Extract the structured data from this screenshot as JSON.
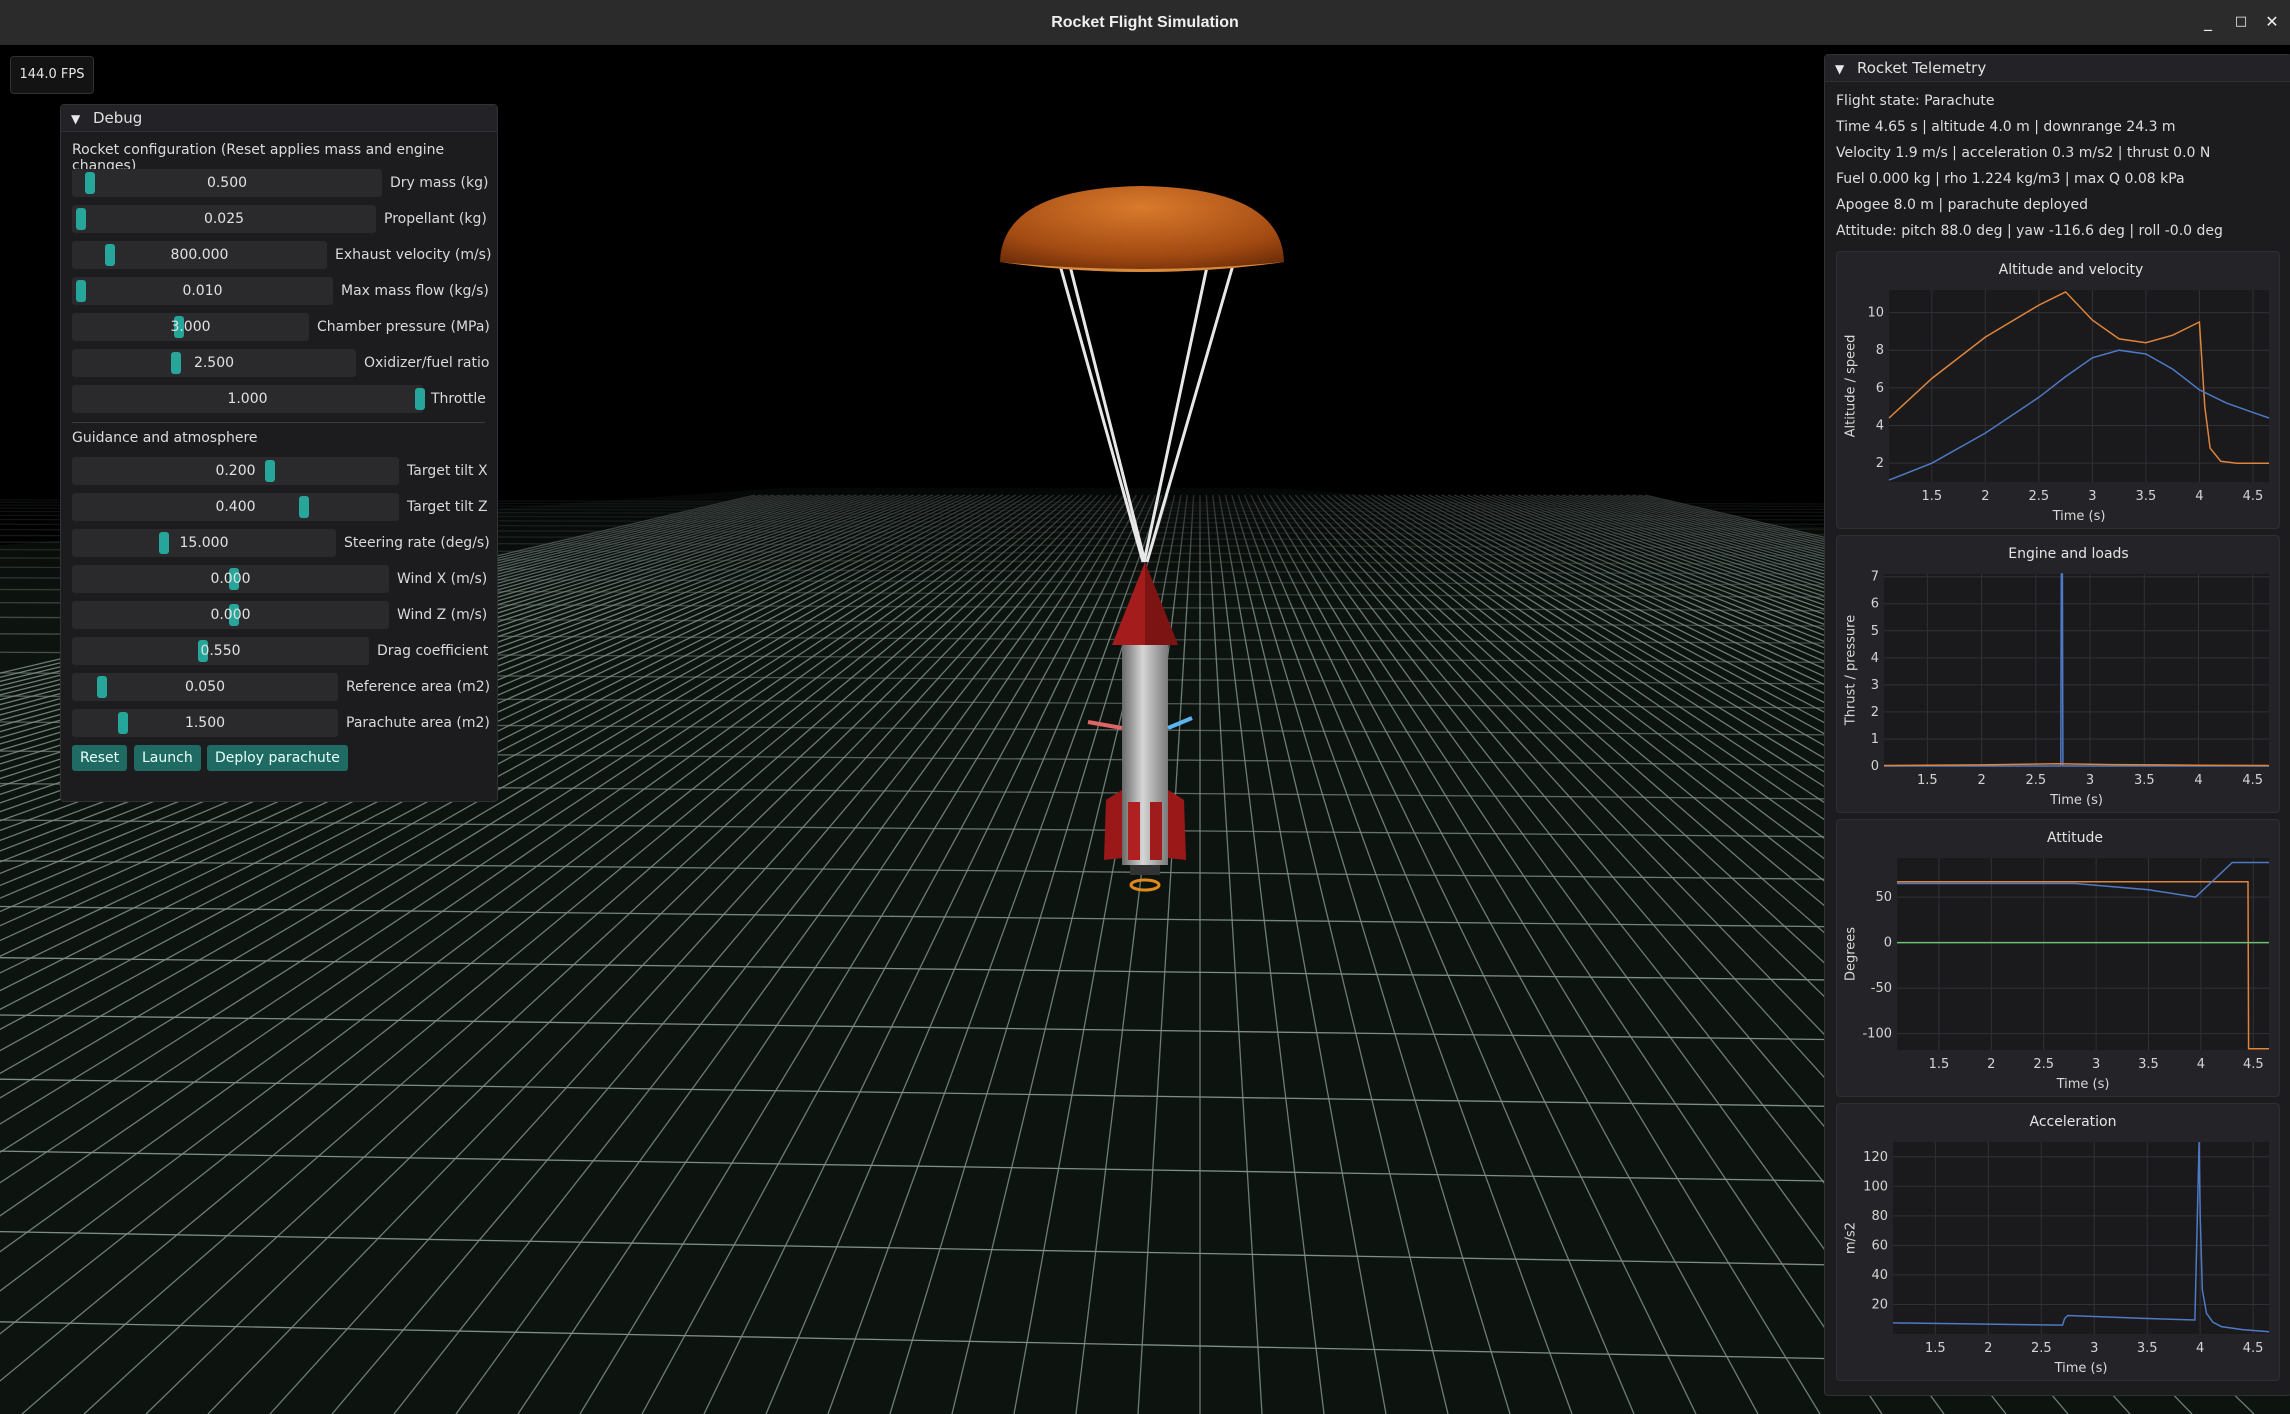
{
  "window": {
    "title": "Rocket Flight Simulation",
    "controls": {
      "minimize": "_",
      "maximize": "□",
      "close": "✕"
    }
  },
  "fps": "144.0 FPS",
  "debug": {
    "header": "Debug",
    "config_title": "Rocket configuration (Reset applies mass and engine changes)",
    "config_sliders": [
      {
        "value": "0.500",
        "label": "Dry mass (kg)"
      },
      {
        "value": "0.025",
        "label": "Propellant (kg)"
      },
      {
        "value": "800.000",
        "label": "Exhaust velocity (m/s)"
      },
      {
        "value": "0.010",
        "label": "Max mass flow (kg/s)"
      },
      {
        "value": "3.000",
        "label": "Chamber pressure (MPa)"
      },
      {
        "value": "2.500",
        "label": "Oxidizer/fuel ratio"
      },
      {
        "value": "1.000",
        "label": "Throttle"
      }
    ],
    "guidance_title": "Guidance and atmosphere",
    "guidance_sliders": [
      {
        "value": "0.200",
        "label": "Target tilt X"
      },
      {
        "value": "0.400",
        "label": "Target tilt Z"
      },
      {
        "value": "15.000",
        "label": "Steering rate (deg/s)"
      },
      {
        "value": "0.000",
        "label": "Wind X (m/s)"
      },
      {
        "value": "0.000",
        "label": "Wind Z (m/s)"
      },
      {
        "value": "0.550",
        "label": "Drag coefficient"
      },
      {
        "value": "0.050",
        "label": "Reference area (m2)"
      },
      {
        "value": "1.500",
        "label": "Parachute area (m2)"
      }
    ],
    "buttons": {
      "reset": "Reset",
      "launch": "Launch",
      "deploy": "Deploy parachute"
    }
  },
  "telemetry": {
    "header": "Rocket Telemetry",
    "lines": [
      "Flight state: Parachute",
      "Time 4.65 s | altitude 4.0 m | downrange 24.3 m",
      "Velocity 1.9 m/s | acceleration 0.3 m/s2 | thrust 0.0 N",
      "Fuel 0.000 kg | rho 1.224 kg/m3 | max Q 0.08 kPa",
      "Apogee 8.0 m | parachute deployed",
      "Attitude: pitch 88.0 deg | yaw -116.6 deg | roll -0.0 deg"
    ],
    "colors": {
      "series_a": "#e0843a",
      "series_b": "#4e79c4",
      "series_c": "#6fbf73"
    }
  },
  "chart_data": [
    {
      "type": "line",
      "title": "Altitude and velocity",
      "xlabel": "Time (s)",
      "ylabel": "Altitude / speed",
      "xlim": [
        1.1,
        4.65
      ],
      "ylim": [
        1,
        11.2
      ],
      "xticks": [
        1.5,
        2,
        2.5,
        3,
        3.5,
        4,
        4.5
      ],
      "yticks": [
        2,
        4,
        6,
        8,
        10
      ],
      "grid": true,
      "series": [
        {
          "color": "#e0843a",
          "x": [
            1.1,
            1.5,
            2.0,
            2.5,
            2.75,
            3.0,
            3.25,
            3.5,
            3.75,
            4.0,
            4.05,
            4.1,
            4.2,
            4.35,
            4.5,
            4.65
          ],
          "y": [
            4.4,
            6.5,
            8.7,
            10.4,
            11.1,
            9.6,
            8.6,
            8.4,
            8.8,
            9.5,
            5.0,
            2.8,
            2.1,
            2.0,
            2.0,
            2.0
          ]
        },
        {
          "color": "#4e79c4",
          "x": [
            1.1,
            1.5,
            2.0,
            2.5,
            2.75,
            3.0,
            3.25,
            3.5,
            3.75,
            4.0,
            4.25,
            4.5,
            4.65
          ],
          "y": [
            1.1,
            2.0,
            3.6,
            5.5,
            6.6,
            7.6,
            8.0,
            7.8,
            7.0,
            5.9,
            5.2,
            4.7,
            4.4
          ]
        }
      ]
    },
    {
      "type": "line",
      "title": "Engine and loads",
      "xlabel": "Time (s)",
      "ylabel": "Thrust / pressure",
      "xlim": [
        1.1,
        4.65
      ],
      "ylim": [
        0,
        7.1
      ],
      "xticks": [
        1.5,
        2,
        2.5,
        3,
        3.5,
        4,
        4.5
      ],
      "yticks": [
        0,
        1,
        2,
        3,
        4,
        5,
        6,
        7
      ],
      "grid": true,
      "series": [
        {
          "color": "#4e79c4",
          "x": [
            1.1,
            2.73,
            2.735,
            2.745,
            2.75,
            4.0,
            4.65
          ],
          "y": [
            0,
            0,
            7.1,
            7.1,
            0,
            0,
            0
          ]
        },
        {
          "color": "#e0843a",
          "x": [
            1.1,
            2.0,
            2.7,
            3.2,
            4.0,
            4.65
          ],
          "y": [
            0.02,
            0.04,
            0.08,
            0.05,
            0.03,
            0.02
          ]
        }
      ]
    },
    {
      "type": "line",
      "title": "Attitude",
      "xlabel": "Time (s)",
      "ylabel": "Degrees",
      "xlim": [
        1.1,
        4.65
      ],
      "ylim": [
        -118,
        93
      ],
      "xticks": [
        1.5,
        2,
        2.5,
        3,
        3.5,
        4,
        4.5
      ],
      "yticks": [
        50,
        0,
        -50,
        -100
      ],
      "grid": true,
      "series": [
        {
          "color": "#e0843a",
          "x": [
            1.1,
            4.45,
            4.455,
            4.65
          ],
          "y": [
            67,
            67,
            -116.6,
            -116.6
          ]
        },
        {
          "color": "#4e79c4",
          "x": [
            1.1,
            2.8,
            3.5,
            3.95,
            4.3,
            4.5,
            4.65
          ],
          "y": [
            65,
            65,
            58,
            50,
            88,
            88,
            88
          ]
        },
        {
          "color": "#6fbf73",
          "x": [
            1.1,
            4.65
          ],
          "y": [
            0,
            0
          ]
        }
      ]
    },
    {
      "type": "line",
      "title": "Acceleration",
      "xlabel": "Time (s)",
      "ylabel": "m/s2",
      "xlim": [
        1.1,
        4.65
      ],
      "ylim": [
        0,
        130
      ],
      "xticks": [
        1.5,
        2,
        2.5,
        3,
        3.5,
        4,
        4.5
      ],
      "yticks": [
        20,
        40,
        60,
        80,
        100,
        120
      ],
      "grid": true,
      "series": [
        {
          "color": "#4e79c4",
          "x": [
            1.1,
            2.7,
            2.72,
            2.75,
            3.5,
            3.95,
            3.99,
            4.0,
            4.02,
            4.06,
            4.12,
            4.2,
            4.4,
            4.65
          ],
          "y": [
            7.5,
            6.0,
            10.5,
            12.5,
            10.5,
            9.5,
            130,
            80,
            30,
            14,
            8,
            5,
            3,
            1.5
          ]
        }
      ]
    }
  ]
}
